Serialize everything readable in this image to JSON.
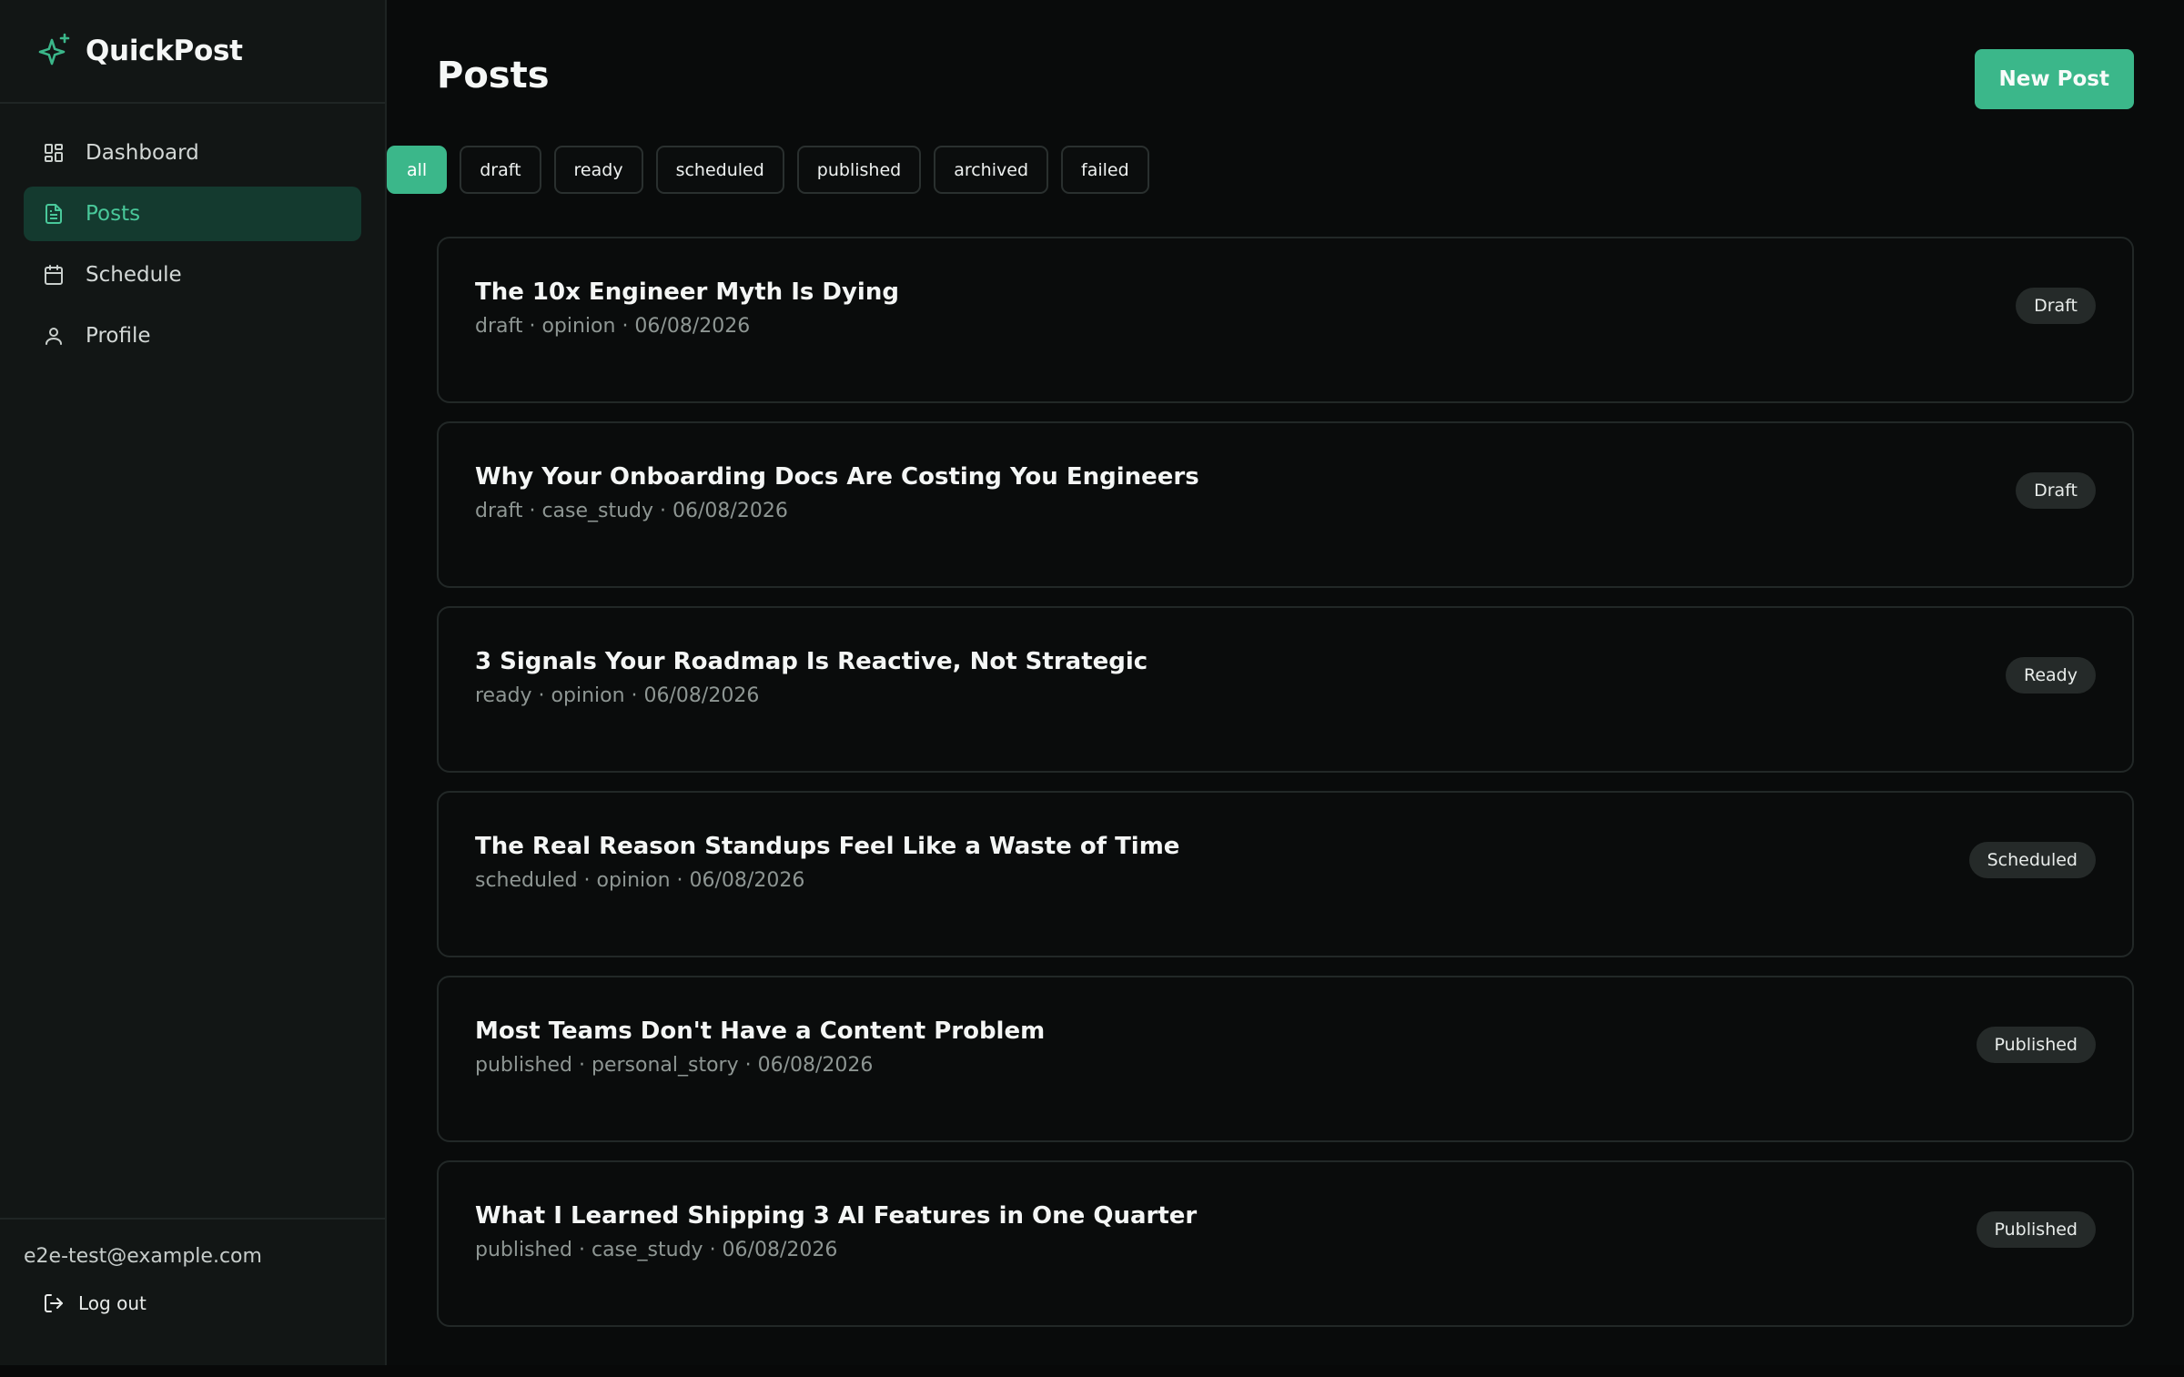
{
  "app": {
    "name": "QuickPost",
    "accent_color": "#3bb78a"
  },
  "sidebar": {
    "items": [
      {
        "label": "Dashboard",
        "icon": "layout-grid-icon",
        "active": false
      },
      {
        "label": "Posts",
        "icon": "file-text-icon",
        "active": true
      },
      {
        "label": "Schedule",
        "icon": "calendar-icon",
        "active": false
      },
      {
        "label": "Profile",
        "icon": "user-icon",
        "active": false
      }
    ],
    "user_email": "e2e-test@example.com",
    "logout_label": "Log out"
  },
  "main": {
    "title": "Posts",
    "new_post_label": "New Post",
    "filters": [
      {
        "label": "all",
        "active": true
      },
      {
        "label": "draft",
        "active": false
      },
      {
        "label": "ready",
        "active": false
      },
      {
        "label": "scheduled",
        "active": false
      },
      {
        "label": "published",
        "active": false
      },
      {
        "label": "archived",
        "active": false
      },
      {
        "label": "failed",
        "active": false
      }
    ],
    "posts": [
      {
        "title": "The 10x Engineer Myth Is Dying",
        "meta": "draft · opinion · 06/08/2026",
        "status": "Draft"
      },
      {
        "title": "Why Your Onboarding Docs Are Costing You Engineers",
        "meta": "draft · case_study · 06/08/2026",
        "status": "Draft"
      },
      {
        "title": "3 Signals Your Roadmap Is Reactive, Not Strategic",
        "meta": "ready · opinion · 06/08/2026",
        "status": "Ready"
      },
      {
        "title": "The Real Reason Standups Feel Like a Waste of Time",
        "meta": "scheduled · opinion · 06/08/2026",
        "status": "Scheduled"
      },
      {
        "title": "Most Teams Don't Have a Content Problem",
        "meta": "published · personal_story · 06/08/2026",
        "status": "Published"
      },
      {
        "title": "What I Learned Shipping 3 AI Features in One Quarter",
        "meta": "published · case_study · 06/08/2026",
        "status": "Published"
      }
    ]
  }
}
